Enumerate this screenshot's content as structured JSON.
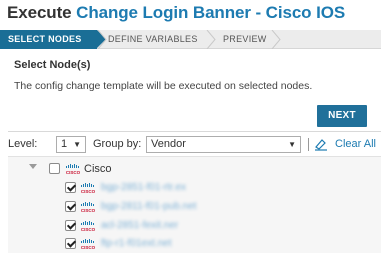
{
  "header": {
    "title_prefix": "Execute",
    "title_template": "Change Login Banner - Cisco IOS"
  },
  "wizard": {
    "steps": [
      {
        "label": "SELECT NODES",
        "active": true
      },
      {
        "label": "DEFINE VARIABLES",
        "active": false
      },
      {
        "label": "PREVIEW",
        "active": false
      }
    ]
  },
  "section": {
    "title": "Select Node(s)",
    "description": "The config change template will be executed on selected nodes."
  },
  "actions": {
    "next_label": "NEXT"
  },
  "toolbar": {
    "level_label": "Level:",
    "level_value": "1",
    "group_by_label": "Group by:",
    "group_by_value": "Vendor",
    "clear_all_label": "Clear All"
  },
  "tree": {
    "group": {
      "label": "Cisco",
      "expanded": true,
      "checked": false,
      "icon": "cisco-logo"
    },
    "nodes": [
      {
        "label": "bgp-2851-f01-rtr.ex",
        "checked": true
      },
      {
        "label": "bgp-2811-f01-pub.net",
        "checked": true
      },
      {
        "label": "acl-2851-fexit.ner",
        "checked": true
      },
      {
        "label": "ftp-r1-f01ext.net",
        "checked": true
      }
    ]
  },
  "colors": {
    "accent": "#1d7bb1",
    "wizard_active": "#1a6e96",
    "button": "#20709a",
    "cisco_red": "#c8102e"
  }
}
